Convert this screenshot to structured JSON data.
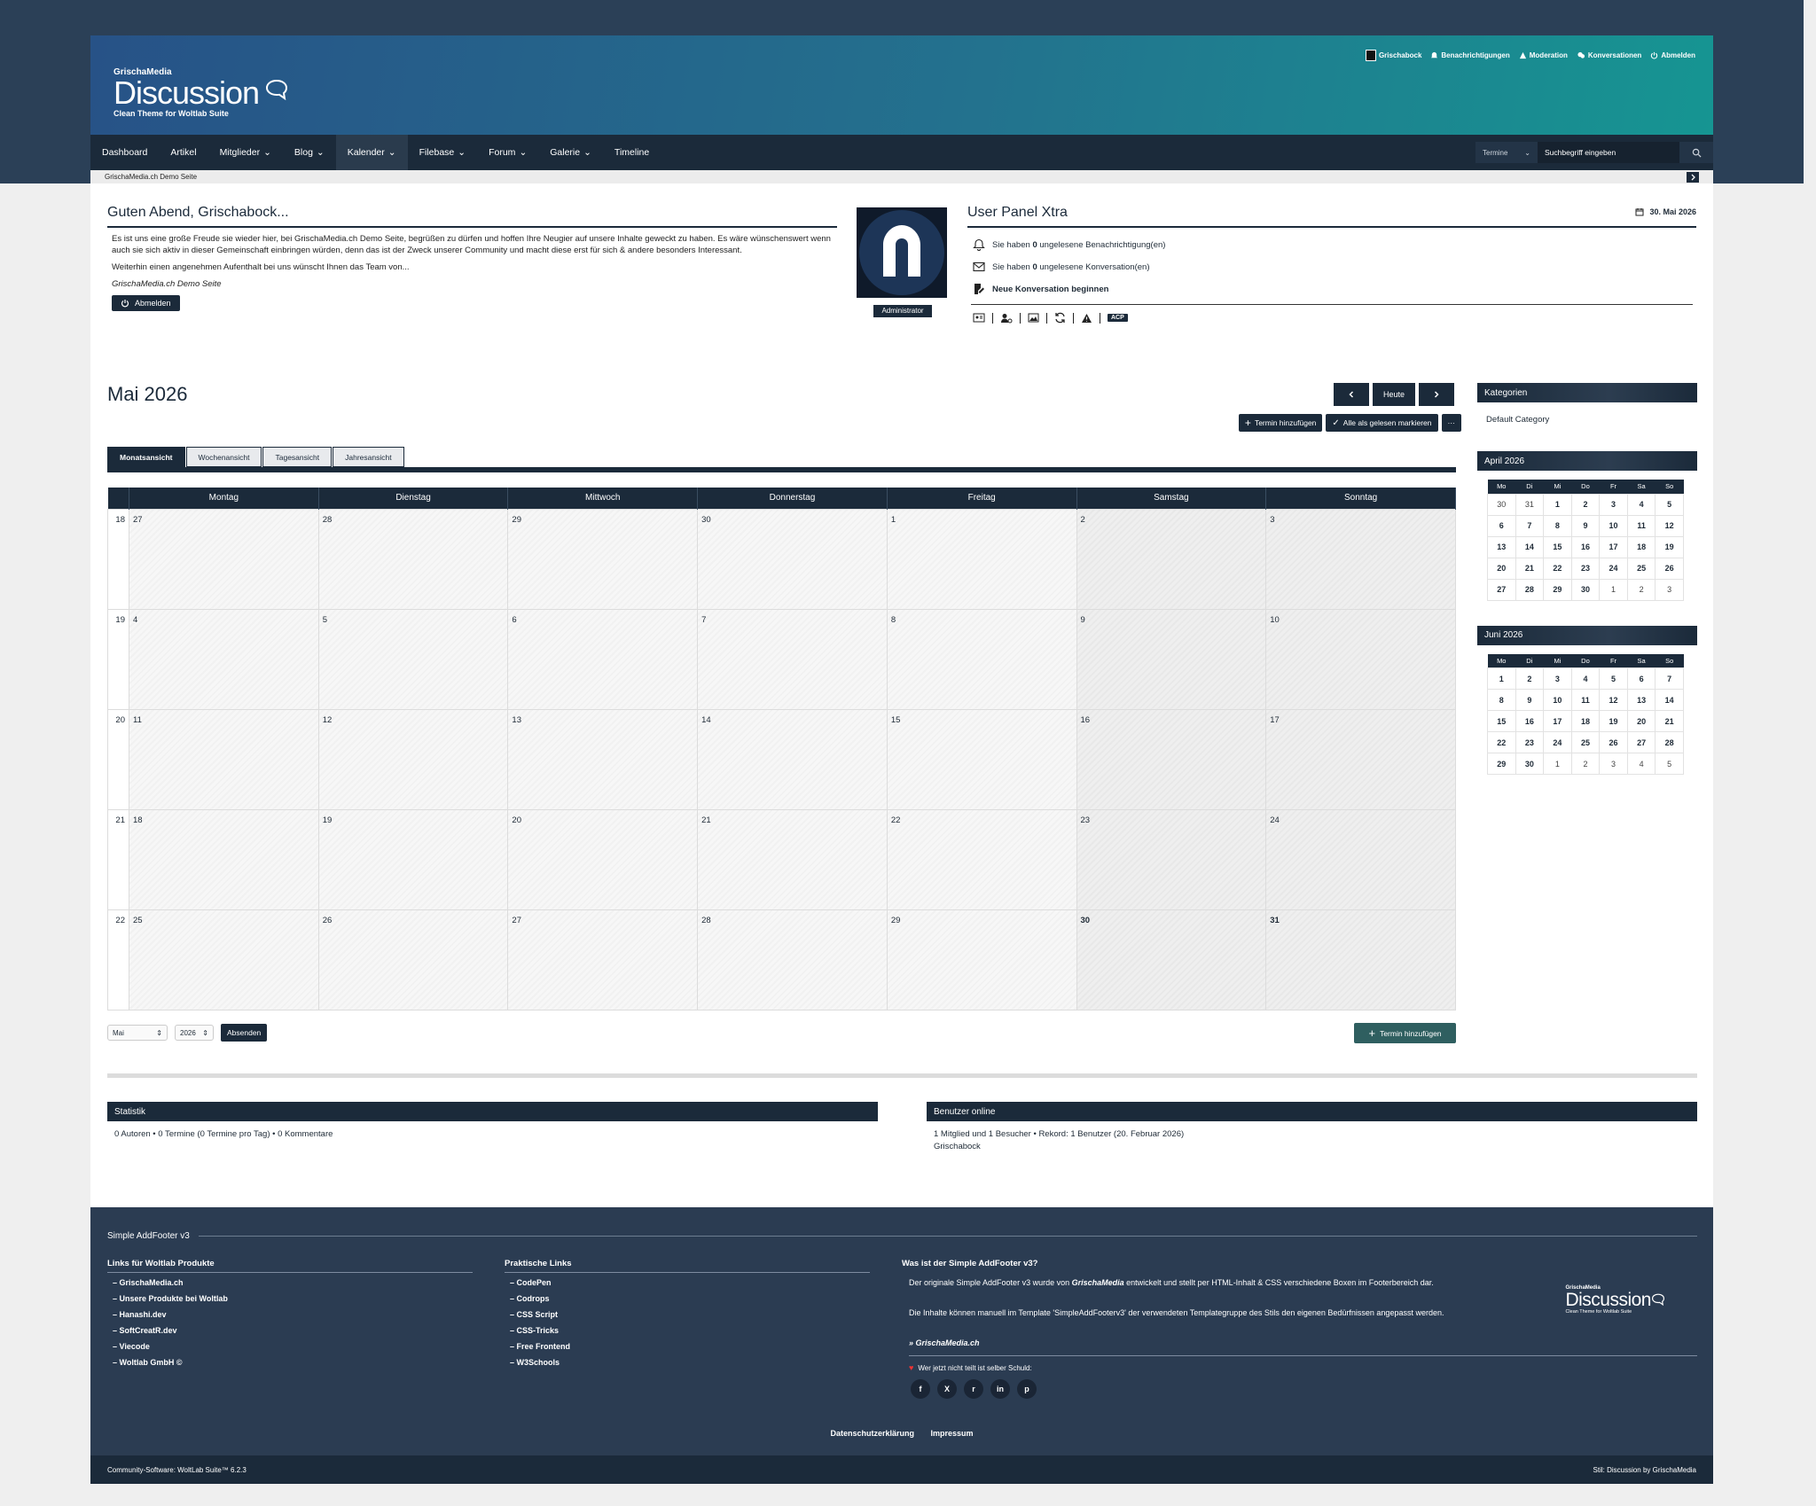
{
  "header": {
    "brand": "GrischaMedia",
    "logo_title": "Discussion",
    "tagline": "Clean Theme for Woltlab Suite",
    "user_menu": [
      "Grischabock",
      "Benachrichtigungen",
      "Moderation",
      "Konversationen",
      "Abmelden"
    ]
  },
  "nav": {
    "items": [
      "Dashboard",
      "Artikel",
      "Mitglieder",
      "Blog",
      "Kalender",
      "Filebase",
      "Forum",
      "Galerie",
      "Timeline"
    ],
    "search_scope": "Termine",
    "search_placeholder": "Suchbegriff eingeben"
  },
  "breadcrumb": "GrischaMedia.ch Demo Seite",
  "greeting": {
    "title": "Guten Abend, Grischabock...",
    "p1": "Es ist uns eine große Freude sie wieder hier, bei GrischaMedia.ch Demo Seite, begrüßen zu dürfen und hoffen Ihre Neugier auf unsere Inhalte geweckt zu haben. Es wäre wünschenswert wenn auch sie sich aktiv in dieser Gemeinschaft einbringen würden, denn das ist der Zweck unserer Community und macht diese erst für sich & andere besonders Interessant.",
    "p2": "Weiterhin einen angenehmen Aufenthalt bei uns wünscht Ihnen das Team von...",
    "sig": "GrischaMedia.ch Demo Seite",
    "logout": "Abmelden"
  },
  "user_panel": {
    "title": "User Panel Xtra",
    "date": "30. Mai 2026",
    "role": "Administrator",
    "notif_pre": "Sie haben ",
    "notif_count": "0",
    "notif_post": " ungelesene Benachrichtigung(en)",
    "conv_pre": "Sie haben ",
    "conv_count": "0",
    "conv_post": " ungelesene Konversation(en)",
    "new_conv": "Neue Konversation beginnen",
    "acp": "ACP"
  },
  "calendar": {
    "title": "Mai 2026",
    "today": "Heute",
    "add_event": "Termin hinzufügen",
    "mark_read": "Alle als gelesen markieren",
    "more": "···",
    "tabs": [
      "Monatsansicht",
      "Wochenansicht",
      "Tagesansicht",
      "Jahresansicht"
    ],
    "weekdays": [
      "Montag",
      "Dienstag",
      "Mittwoch",
      "Donnerstag",
      "Freitag",
      "Samstag",
      "Sonntag"
    ],
    "weeks": [
      {
        "wk": "18",
        "days": [
          "27",
          "28",
          "29",
          "30",
          "1",
          "2",
          "3"
        ]
      },
      {
        "wk": "19",
        "days": [
          "4",
          "5",
          "6",
          "7",
          "8",
          "9",
          "10"
        ]
      },
      {
        "wk": "20",
        "days": [
          "11",
          "12",
          "13",
          "14",
          "15",
          "16",
          "17"
        ]
      },
      {
        "wk": "21",
        "days": [
          "18",
          "19",
          "20",
          "21",
          "22",
          "23",
          "24"
        ]
      },
      {
        "wk": "22",
        "days": [
          "25",
          "26",
          "27",
          "28",
          "29",
          "30",
          "31"
        ]
      }
    ],
    "month_select": "Mai",
    "year_select": "2026",
    "submit": "Absenden"
  },
  "stats": {
    "title": "Statistik",
    "text": "0 Autoren • 0 Termine (0 Termine pro Tag) • 0 Kommentare"
  },
  "online": {
    "title": "Benutzer online",
    "text": "1 Mitglied und 1 Besucher • Rekord: 1 Benutzer (20. Februar 2026)",
    "user": "Grischabock"
  },
  "sidebar": {
    "categories_title": "Kategorien",
    "category": "Default Category",
    "mini_days": [
      "Mo",
      "Di",
      "Mi",
      "Do",
      "Fr",
      "Sa",
      "So"
    ],
    "april": {
      "title": "April 2026",
      "rows": [
        [
          "30",
          "31",
          "1",
          "2",
          "3",
          "4",
          "5"
        ],
        [
          "6",
          "7",
          "8",
          "9",
          "10",
          "11",
          "12"
        ],
        [
          "13",
          "14",
          "15",
          "16",
          "17",
          "18",
          "19"
        ],
        [
          "20",
          "21",
          "22",
          "23",
          "24",
          "25",
          "26"
        ],
        [
          "27",
          "28",
          "29",
          "30",
          "1",
          "2",
          "3"
        ]
      ]
    },
    "june": {
      "title": "Juni 2026",
      "rows": [
        [
          "1",
          "2",
          "3",
          "4",
          "5",
          "6",
          "7"
        ],
        [
          "8",
          "9",
          "10",
          "11",
          "12",
          "13",
          "14"
        ],
        [
          "15",
          "16",
          "17",
          "18",
          "19",
          "20",
          "21"
        ],
        [
          "22",
          "23",
          "24",
          "25",
          "26",
          "27",
          "28"
        ],
        [
          "29",
          "30",
          "1",
          "2",
          "3",
          "4",
          "5"
        ]
      ]
    }
  },
  "footer": {
    "title": "Simple AddFooter v3",
    "col1_title": "Links für Woltlab Produkte",
    "col1": [
      "GrischaMedia.ch",
      "Unsere Produkte bei Woltlab",
      "Hanashi.dev",
      "SoftCreatR.dev",
      "Viecode",
      "Woltlab GmbH ©"
    ],
    "col2_title": "Praktische Links",
    "col2": [
      "CodePen",
      "Codrops",
      "CSS Script",
      "CSS-Tricks",
      "Free Frontend",
      "W3Schools"
    ],
    "col3_title": "Was ist der Simple AddFooter v3?",
    "col3_p1_pre": "Der originale Simple AddFooter v3 wurde von ",
    "col3_p1_brand": "GrischaMedia",
    "col3_p1_post": " entwickelt und stellt per HTML-Inhalt & CSS verschiedene Boxen im Footerbereich dar.",
    "col3_p2": "Die Inhalte können manuell im Template 'SimpleAddFooterv3' der verwendeten Templategruppe des Stils den eigenen Bedürfnissen angepasst werden.",
    "col3_link": "» GrischaMedia.ch",
    "share": "Wer jetzt nicht teilt ist selber Schuld:",
    "social": [
      "f",
      "X",
      "r",
      "in",
      "p"
    ],
    "logo_brand": "GrischaMedia",
    "logo_title": "Discussion",
    "logo_tagline": "Clean Theme for Woltlab Suite",
    "links": [
      "Datenschutzerklärung",
      "Impressum"
    ],
    "software": "Community-Software: WoltLab Suite™ 6.2.3",
    "style": "Stil: Discussion by GrischaMedia"
  }
}
